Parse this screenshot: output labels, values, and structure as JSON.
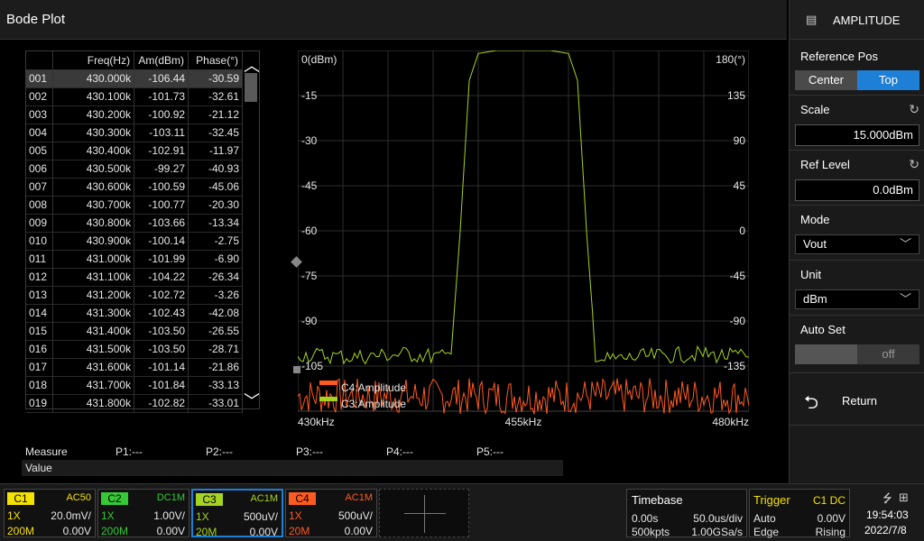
{
  "title": "Bode Plot",
  "table": {
    "headers": [
      "",
      "Freq(Hz)",
      "Am(dBm)",
      "Phase(°)"
    ],
    "rows": [
      [
        "001",
        "430.000k",
        "-106.44",
        "-30.59"
      ],
      [
        "002",
        "430.100k",
        "-101.73",
        "-32.61"
      ],
      [
        "003",
        "430.200k",
        "-100.92",
        "-21.12"
      ],
      [
        "004",
        "430.300k",
        "-103.11",
        "-32.45"
      ],
      [
        "005",
        "430.400k",
        "-102.91",
        "-11.97"
      ],
      [
        "006",
        "430.500k",
        "-99.27",
        "-40.93"
      ],
      [
        "007",
        "430.600k",
        "-100.59",
        "-45.06"
      ],
      [
        "008",
        "430.700k",
        "-100.77",
        "-20.30"
      ],
      [
        "009",
        "430.800k",
        "-103.66",
        "-13.34"
      ],
      [
        "010",
        "430.900k",
        "-100.14",
        "-2.75"
      ],
      [
        "011",
        "431.000k",
        "-101.99",
        "-6.90"
      ],
      [
        "012",
        "431.100k",
        "-104.22",
        "-26.34"
      ],
      [
        "013",
        "431.200k",
        "-102.72",
        "-3.26"
      ],
      [
        "014",
        "431.300k",
        "-102.43",
        "-42.08"
      ],
      [
        "015",
        "431.400k",
        "-103.50",
        "-26.55"
      ],
      [
        "016",
        "431.500k",
        "-103.50",
        "-28.71"
      ],
      [
        "017",
        "431.600k",
        "-101.14",
        "-21.86"
      ],
      [
        "018",
        "431.700k",
        "-101.84",
        "-33.13"
      ],
      [
        "019",
        "431.800k",
        "-102.82",
        "-33.01"
      ]
    ]
  },
  "chart_data": {
    "type": "line",
    "x_ticks": [
      "430kHz",
      "455kHz",
      "480kHz"
    ],
    "xlim": [
      430,
      480
    ],
    "y_left_ticks": [
      "0(dBm)",
      "-15",
      "-30",
      "-45",
      "-60",
      "-75",
      "-90",
      "-105"
    ],
    "y_right_ticks": [
      "180(°)",
      "135",
      "90",
      "45",
      "0",
      "-45",
      "-90",
      "-135"
    ],
    "ylim_left": [
      -120,
      0
    ],
    "ylim_right": [
      -180,
      180
    ],
    "legend": [
      "C4:Amplitude",
      "C3:Amplitude"
    ],
    "series": [
      {
        "name": "C3:Amplitude",
        "color": "#a4d321",
        "x": [
          430,
          436,
          442,
          446,
          447,
          448,
          449,
          450,
          452,
          455,
          458,
          460,
          461,
          462,
          463,
          464,
          468,
          474,
          480
        ],
        "y": [
          -101,
          -102,
          -101,
          -102,
          -101,
          -60,
          -10,
          -1,
          0,
          0,
          0,
          -1,
          -10,
          -60,
          -101,
          -103,
          -102,
          -101,
          -102
        ]
      },
      {
        "name": "C4:Amplitude",
        "color": "#ff5a1f",
        "x": [
          430,
          480
        ],
        "y": [
          -115,
          -115
        ]
      }
    ]
  },
  "measure": {
    "label": "Measure",
    "p1": "P1:---",
    "p2": "P2:---",
    "p3": "P3:---",
    "p4": "P4:---",
    "p5": "P5:---",
    "value_label": "Value"
  },
  "panel": {
    "title": "AMPLITUDE",
    "ref_pos_label": "Reference Pos",
    "ref_center": "Center",
    "ref_top": "Top",
    "scale_label": "Scale",
    "scale_value": "15.000dBm",
    "ref_level_label": "Ref Level",
    "ref_level_value": "0.0dBm",
    "mode_label": "Mode",
    "mode_value": "Vout",
    "unit_label": "Unit",
    "unit_value": "dBm",
    "auto_set_label": "Auto Set",
    "auto_set_value": "off",
    "return_label": "Return"
  },
  "channels": [
    {
      "tag": "C1",
      "coupling": "AC50",
      "probe": "1X",
      "scale": "20.0mV/",
      "bw": "200M",
      "offset": "0.00V",
      "color": "#f5e100"
    },
    {
      "tag": "C2",
      "coupling": "DC1M",
      "probe": "1X",
      "scale": "1.00V/",
      "bw": "200M",
      "offset": "0.00V",
      "color": "#35c935"
    },
    {
      "tag": "C3",
      "coupling": "AC1M",
      "probe": "1X",
      "scale": "500uV/",
      "bw": "20M",
      "offset": "0.00V",
      "color": "#a4d321"
    },
    {
      "tag": "C4",
      "coupling": "AC1M",
      "probe": "1X",
      "scale": "500uV/",
      "bw": "20M",
      "offset": "0.00V",
      "color": "#ff5a1f"
    }
  ],
  "timebase": {
    "label": "Timebase",
    "delay": "0.00s",
    "scale": "50.0us/div",
    "points": "500kpts",
    "rate": "1.00GSa/s"
  },
  "trigger": {
    "label": "Trigger",
    "source": "C1 DC",
    "mode": "Auto",
    "level": "0.00V",
    "type": "Edge",
    "slope": "Rising"
  },
  "clock": {
    "time": "19:54:03",
    "date": "2022/7/8"
  }
}
